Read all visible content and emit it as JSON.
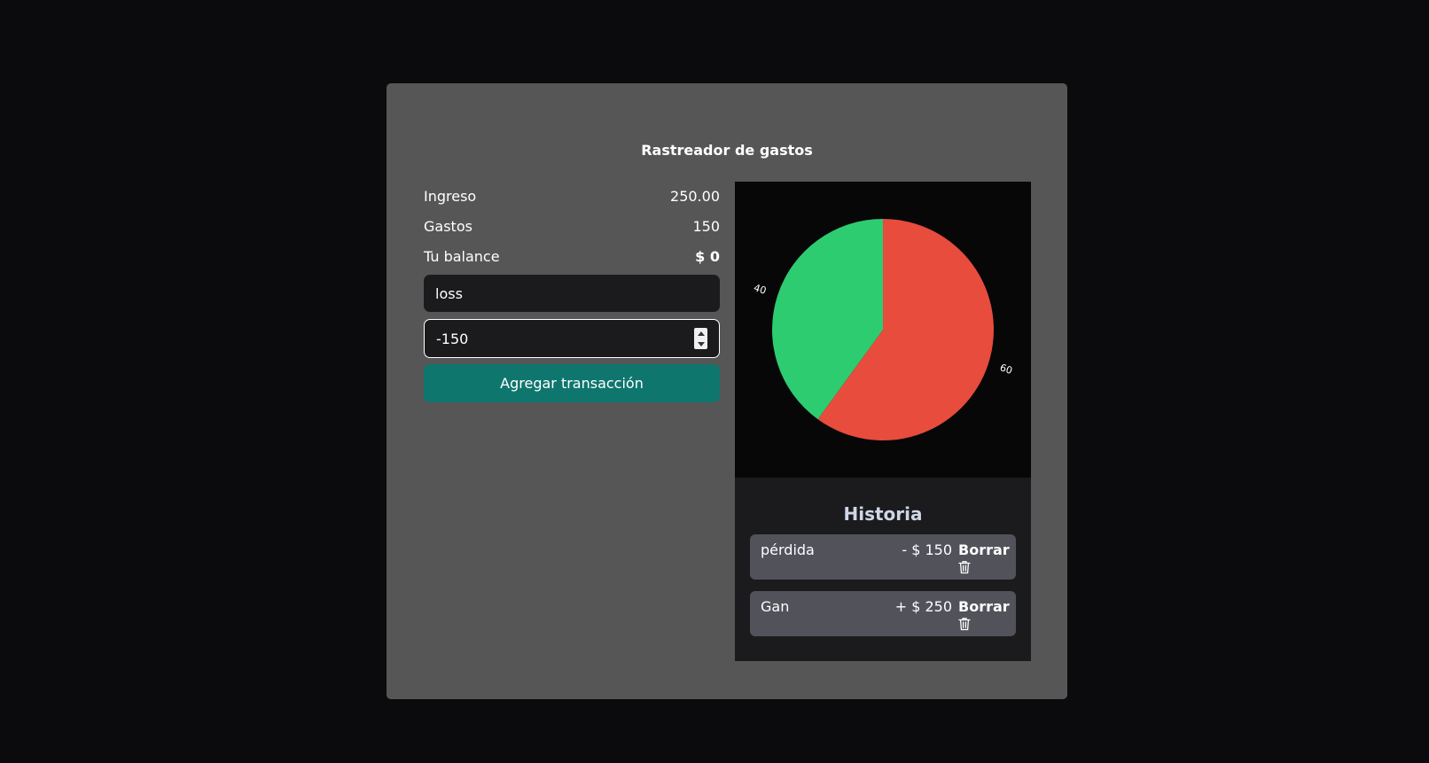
{
  "app": {
    "title": "Rastreador de gastos"
  },
  "summary": {
    "income_label": "Ingreso",
    "income_value": "250.00",
    "expenses_label": "Gastos",
    "expenses_value": "150",
    "balance_label": "Tu balance",
    "balance_value": "$ 0"
  },
  "form": {
    "description_value": "loss",
    "amount_value": "-150",
    "submit_label": "Agregar transacción"
  },
  "history": {
    "title": "Historia",
    "items": [
      {
        "label": "pérdida",
        "amount": "- $ 150",
        "delete_label": "Borrar"
      },
      {
        "label": "Gan",
        "amount": "+ $ 250",
        "delete_label": "Borrar"
      }
    ]
  },
  "chart_data": {
    "type": "pie",
    "slices": [
      {
        "value": 60,
        "label": "60",
        "color": "#e74c3c"
      },
      {
        "value": 40,
        "label": "40",
        "color": "#2ecc71"
      }
    ]
  },
  "colors": {
    "background": "#0b0b0d",
    "card": "#565656",
    "button": "#0f766e",
    "history_item": "#52525b"
  }
}
